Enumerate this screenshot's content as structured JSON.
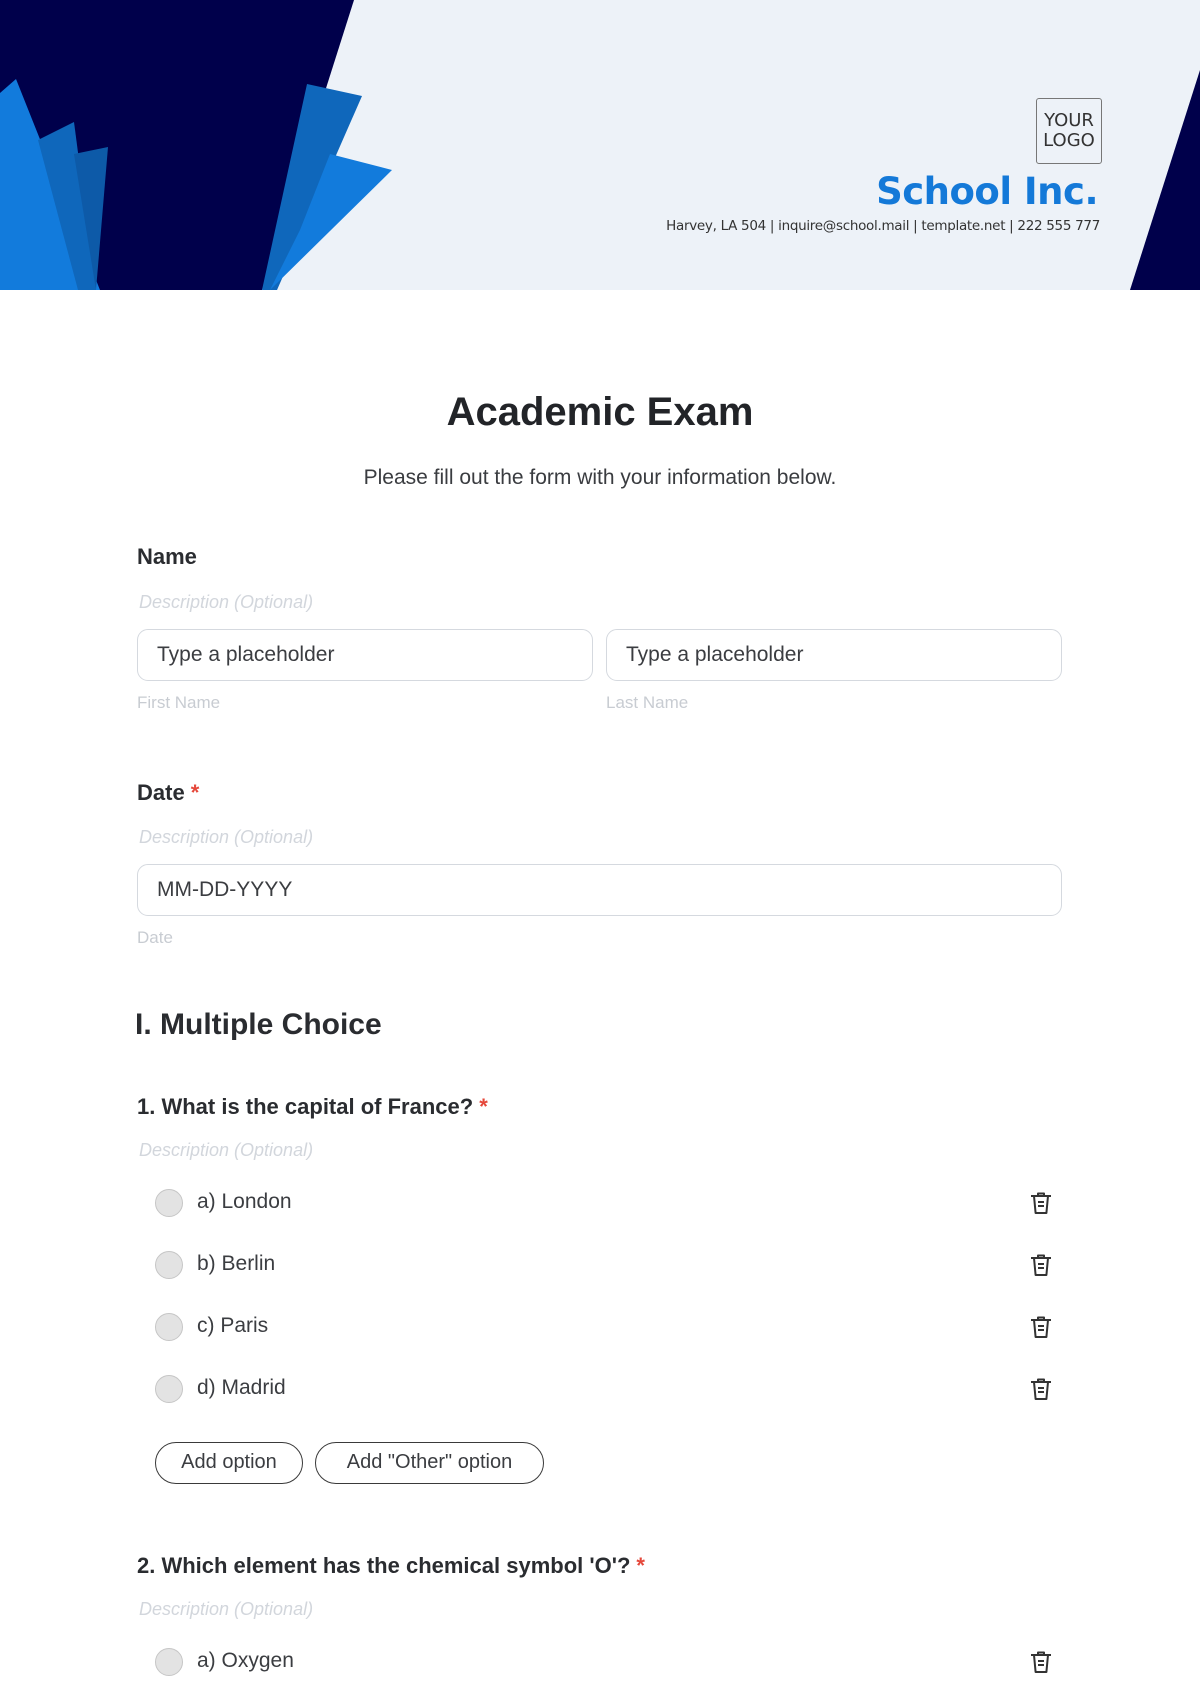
{
  "header": {
    "logo_line1": "YOUR",
    "logo_line2": "LOGO",
    "school_name": "School Inc.",
    "contact": "Harvey, LA 504 | inquire@school.mail | template.net | 222 555 777",
    "colors": {
      "navy": "#00004b",
      "blue": "#127bdc",
      "mid_blue": "#0f67bb",
      "background": "#edf2f8"
    }
  },
  "form": {
    "title": "Academic Exam",
    "subtitle": "Please fill out the form with your information below.",
    "required_mark": "*",
    "name_field": {
      "label": "Name",
      "description": "Description (Optional)",
      "first": {
        "placeholder": "Type a placeholder",
        "sublabel": "First Name"
      },
      "last": {
        "placeholder": "Type a placeholder",
        "sublabel": "Last Name"
      }
    },
    "date_field": {
      "label": "Date",
      "description": "Description (Optional)",
      "placeholder": "MM-DD-YYYY",
      "sublabel": "Date"
    },
    "section_title": "I. Multiple Choice",
    "questions": [
      {
        "label": "1. What is the capital of France?",
        "description": "Description (Optional)",
        "options": [
          "a) London",
          "b) Berlin",
          "c) Paris",
          "d) Madrid"
        ],
        "add_option_label": "Add option",
        "add_other_label": "Add \"Other\" option"
      },
      {
        "label": "2. Which element has the chemical symbol 'O'?",
        "description": "Description (Optional)",
        "options": [
          "a) Oxygen"
        ]
      }
    ]
  }
}
